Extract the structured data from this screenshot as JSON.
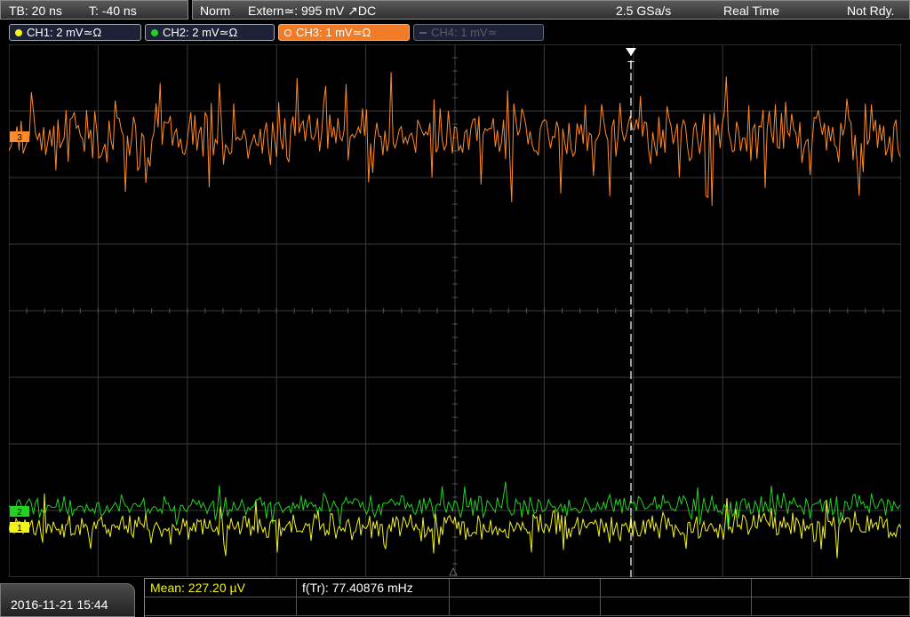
{
  "header": {
    "timebase": "TB: 20 ns",
    "trigger_time": "T: -40 ns",
    "acq_mode": "Norm",
    "trigger_source": "Extern≃: 995 mV ↗DC",
    "sample_rate": "2.5 GSa/s",
    "acq_type": "Real Time",
    "trigger_status": "Not Rdy."
  },
  "channels": [
    {
      "label": "CH1: 2 mV≃Ω",
      "color": "#f2f21c",
      "active": true
    },
    {
      "label": "CH2: 2 mV≃Ω",
      "color": "#22d222",
      "active": true
    },
    {
      "label": "CH3: 1 mV≃Ω",
      "color": "#ff8a2a",
      "active": true,
      "selected": true
    },
    {
      "label": "CH4: 1 mV≃",
      "color": "#5d5d6a",
      "active": false
    }
  ],
  "trigger_marker": "T",
  "channel_markers": [
    "1",
    "2",
    "3"
  ],
  "footer": {
    "datetime": "2016-11-21 15:44",
    "measurements": [
      {
        "label": "Mean: 227.20 µV",
        "color": "#f2f21c"
      },
      {
        "label": "f(Tr): 77.40876 mHz",
        "color": "#ffffff"
      }
    ]
  },
  "colors": {
    "grid": "#3a3a3a",
    "ch1": "#f2f21c",
    "ch2": "#22d222",
    "ch3": "#ff8a2a",
    "trigger_line": "#ffffff"
  }
}
